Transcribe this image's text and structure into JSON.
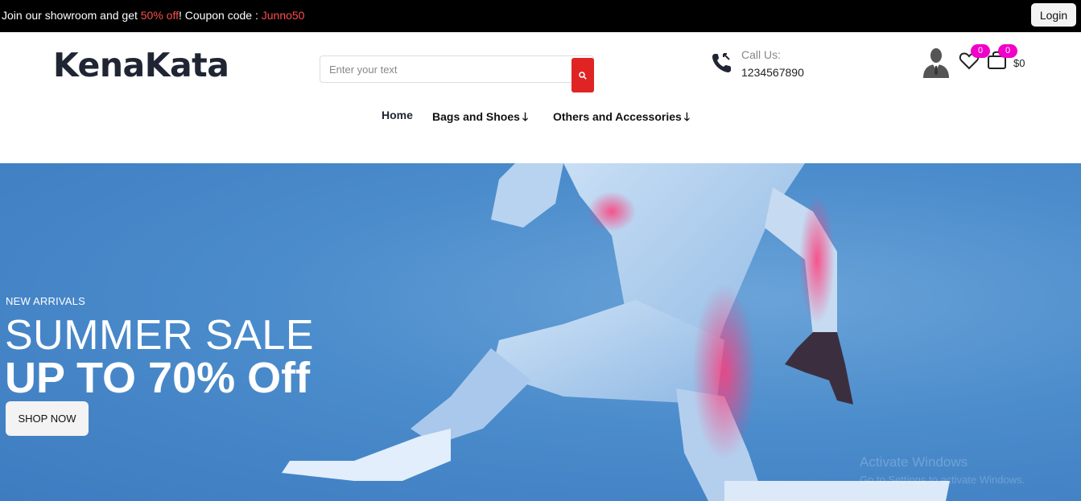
{
  "topbar": {
    "promo_prefix": "Join our showroom and get ",
    "promo_discount": "50% off",
    "promo_middle": "! Coupon code : ",
    "promo_code": "Junno50",
    "login_label": "Login"
  },
  "header": {
    "logo": "KenaKata",
    "search_placeholder": "Enter your text",
    "call_label": "Call Us:",
    "call_number": "1234567890",
    "wishlist_count": "0",
    "cart_count": "0",
    "cart_total": "$0"
  },
  "nav": {
    "home": "Home",
    "bags": "Bags and Shoes",
    "others": "Others and Accessories",
    "arrow": "🡓"
  },
  "hero": {
    "eyebrow": "NEW ARRIVALS",
    "title": "SUMMER SALE",
    "offer": "UP TO 70% Off",
    "cta": "SHOP NOW",
    "watermark_line1": "Activate Windows",
    "watermark_line2": "Go to Settings to activate Windows."
  },
  "colors": {
    "accent_red": "#e02424",
    "badge_magenta": "#f000c8",
    "hero_blue": "#4b8ccc"
  }
}
